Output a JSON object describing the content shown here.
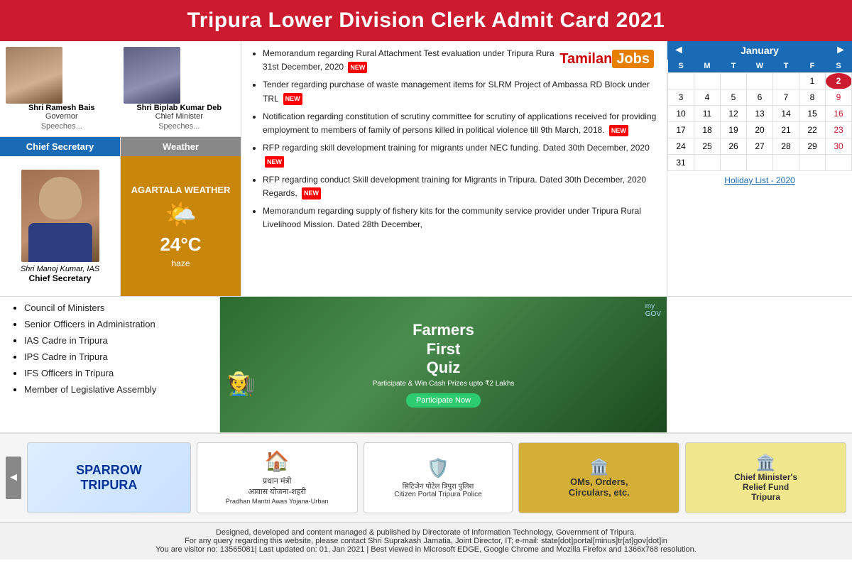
{
  "header": {
    "title": "Tripura Lower Division Clerk Admit Card 2021"
  },
  "officials": {
    "governor": {
      "name": "Shri Ramesh Bais",
      "title": "Governor",
      "speeches": "Speeches..."
    },
    "chief_minister": {
      "name": "Shri Biplab Kumar Deb",
      "title": "Chief Minister",
      "speeches": "Speeches..."
    }
  },
  "chief_secretary": {
    "tab_label": "Chief Secretary",
    "name": "Shri Manoj Kumar, IAS",
    "title": "Chief Secretary"
  },
  "weather": {
    "tab_label": "Weather",
    "city": "AGARTALA WEATHER",
    "temperature": "24°C",
    "description": "haze"
  },
  "news": [
    {
      "text": "Memorandum regarding Rural Attachment Test evaluation under Tripura Rural Livelihood Mission. Dated 31st December, 2020",
      "is_new": true
    },
    {
      "text": "Tender regarding purchase of waste management items for SLRM Project of Ambassa RD Block under TRL",
      "is_new": true
    },
    {
      "text": "Notification regarding constitution of scrutiny committee for scrutiny of applications received for providing employment to members of family of persons killed in political violence till 9th March, 2018.",
      "is_new": true
    },
    {
      "text": "RFP regarding skill development training for migrants under NEC funding. Dated 30th December, 2020",
      "is_new": true
    },
    {
      "text": "RFP regarding conduct Skill development training for Migrants in Tripura. Dated 30th December, 2020 Regards,",
      "is_new": true
    },
    {
      "text": "Memorandum regarding supply of fishery kits for the community service provider under Tripura Rural Livelihood Mission. Dated 28th December,",
      "is_new": false
    }
  ],
  "tamilan_jobs": {
    "tamilan": "Tamilan",
    "jobs": "Jobs"
  },
  "calendar": {
    "month": "January",
    "prev_btn": "◄",
    "next_btn": "►",
    "days_header": [
      "S",
      "M",
      "T",
      "W",
      "T",
      "F",
      "S"
    ],
    "weeks": [
      [
        "",
        "",
        "",
        "",
        "",
        "1",
        "2"
      ],
      [
        "3",
        "4",
        "5",
        "6",
        "7",
        "8",
        "9"
      ],
      [
        "10",
        "11",
        "12",
        "13",
        "14",
        "15",
        "16"
      ],
      [
        "17",
        "18",
        "19",
        "20",
        "21",
        "22",
        "23"
      ],
      [
        "24",
        "25",
        "26",
        "27",
        "28",
        "29",
        "30"
      ],
      [
        "31",
        "",
        "",
        "",
        "",
        "",
        ""
      ]
    ],
    "holiday_link": "Holiday List - 2020",
    "today_date": "2"
  },
  "links": [
    "Council of Ministers",
    "Senior Officers in Administration",
    "IAS Cadre in Tripura",
    "IPS Cadre in Tripura",
    "IFS Officers in Tripura",
    "Member of Legislative Assembly"
  ],
  "ad": {
    "top_label": "my GOV",
    "subtitle": "Farmers First Quiz",
    "prize_text": "Participate & Win Cash Prizes upto ₹2 Lakhs",
    "btn_label": "Participate Now"
  },
  "banners": [
    {
      "id": "sparrow",
      "line1": "SPARROW",
      "line2": "TRIPURA"
    },
    {
      "id": "pradhan",
      "logo": "🏠",
      "text": "प्रधान मंत्री\nआवास योजना-शहरी\nPradhan Mantri Awas Yojana-Urban"
    },
    {
      "id": "police",
      "logo": "🛡️",
      "text": "Citizen Portal Tripura Police"
    },
    {
      "id": "oms",
      "logo": "🏛️",
      "text": "OMs, Orders,\nCirculars, etc."
    },
    {
      "id": "cm_relief",
      "logo": "🏛️",
      "text": "Chief Minister's\nRelief Fund\nTripura"
    }
  ],
  "footer": {
    "line1": "Designed, developed and content managed & published by Directorate of Information Technology, Government of Tripura.",
    "line2": "For any query regarding this website, please contact Shri Suprakash Jamatia, Joint Director, IT; e-mail: state[dot]portal[minus]tr[at]gov[dot]in",
    "line3": "You are visitor no: 13565081| Last updated on: 01, Jan 2021 | Best viewed in Microsoft EDGE, Google Chrome and Mozilla Firefox and 1366x768 resolution."
  }
}
